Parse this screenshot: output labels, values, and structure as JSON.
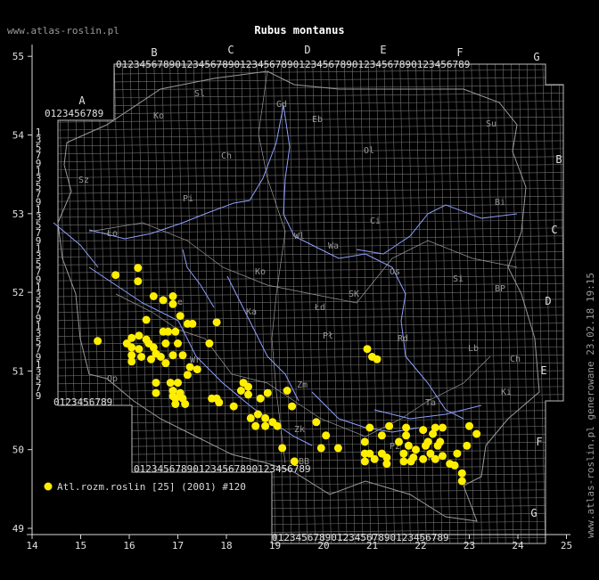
{
  "site": "www.atlas-roslin.pl",
  "title": "Rubus montanus",
  "footer_vertical": "www.atlas-roslin.pl generowane 23.02.18 19:15",
  "legend": {
    "label": "Atl.rozm.roslin [25] (2001) #120",
    "marker_color": "#ffee00"
  },
  "axes": {
    "lon_ticks": [
      "14",
      "15",
      "16",
      "17",
      "18",
      "19",
      "20",
      "21",
      "22",
      "23",
      "24",
      "25"
    ],
    "lat_ticks": [
      "49",
      "50",
      "51",
      "52",
      "53",
      "54",
      "55"
    ]
  },
  "grid_letters_top": [
    "A",
    "B",
    "C",
    "D",
    "E",
    "F",
    "G"
  ],
  "grid_letters_right": [
    "B",
    "C",
    "D",
    "E",
    "F",
    "G"
  ],
  "digit_row": "0123456789",
  "region_labels": [
    "Sl",
    "Gd",
    "Eb",
    "Ko",
    "Su",
    "Ch",
    "Ol",
    "Sz",
    "Pi",
    "Bi",
    "Ci",
    "Wl",
    "Ło",
    "Wa",
    "Ko",
    "Os",
    "Si",
    "BP",
    "Le",
    "Ka",
    "Łd",
    "SK",
    "Rd",
    "Wr",
    "Pł",
    "Lb",
    "Ch",
    "Op",
    "Zm",
    "Ki",
    "Ta",
    "Pz",
    "Kr",
    "BB",
    "Zk"
  ],
  "colors": {
    "background": "#000000",
    "grid": "#707070",
    "rivers": "#8ea0ff",
    "borders": "#9a9a9a",
    "points": "#ffee00",
    "axis": "#d8d8d8"
  },
  "chart_data": {
    "type": "scatter",
    "title": "Rubus montanus",
    "series": [
      {
        "name": "Atl.rozm.roslin [25] (2001) #120",
        "points": [
          [
            15.72,
            52.22
          ],
          [
            16.18,
            52.31
          ],
          [
            16.18,
            52.14
          ],
          [
            15.35,
            51.38
          ],
          [
            15.95,
            51.35
          ],
          [
            16.05,
            51.42
          ],
          [
            16.05,
            51.3
          ],
          [
            16.05,
            51.2
          ],
          [
            16.2,
            51.45
          ],
          [
            16.35,
            51.4
          ],
          [
            16.4,
            51.35
          ],
          [
            16.2,
            51.28
          ],
          [
            16.25,
            51.18
          ],
          [
            16.05,
            51.12
          ],
          [
            16.5,
            51.3
          ],
          [
            16.55,
            51.22
          ],
          [
            16.65,
            51.18
          ],
          [
            16.45,
            51.15
          ],
          [
            16.8,
            51.5
          ],
          [
            16.7,
            51.5
          ],
          [
            16.95,
            51.5
          ],
          [
            16.9,
            51.85
          ],
          [
            17.05,
            51.7
          ],
          [
            16.7,
            51.9
          ],
          [
            16.9,
            51.95
          ],
          [
            17.2,
            51.6
          ],
          [
            17.3,
            51.6
          ],
          [
            17.8,
            51.62
          ],
          [
            17.65,
            51.35
          ],
          [
            16.5,
            51.95
          ],
          [
            16.35,
            51.65
          ],
          [
            16.75,
            51.35
          ],
          [
            17.0,
            51.35
          ],
          [
            17.1,
            51.2
          ],
          [
            16.9,
            51.2
          ],
          [
            16.75,
            51.1
          ],
          [
            17.25,
            51.05
          ],
          [
            17.4,
            51.02
          ],
          [
            17.2,
            50.95
          ],
          [
            16.55,
            50.85
          ],
          [
            16.55,
            50.72
          ],
          [
            16.85,
            50.85
          ],
          [
            17.0,
            50.85
          ],
          [
            16.9,
            50.75
          ],
          [
            17.05,
            50.72
          ],
          [
            16.95,
            50.65
          ],
          [
            17.1,
            50.65
          ],
          [
            16.95,
            50.58
          ],
          [
            17.15,
            50.58
          ],
          [
            16.9,
            50.68
          ],
          [
            17.7,
            50.65
          ],
          [
            17.85,
            50.6
          ],
          [
            17.8,
            50.65
          ],
          [
            18.15,
            50.55
          ],
          [
            18.35,
            50.85
          ],
          [
            18.45,
            50.8
          ],
          [
            18.3,
            50.75
          ],
          [
            18.45,
            50.7
          ],
          [
            18.7,
            50.65
          ],
          [
            18.85,
            50.72
          ],
          [
            19.25,
            50.75
          ],
          [
            19.35,
            50.55
          ],
          [
            18.5,
            50.4
          ],
          [
            18.65,
            50.45
          ],
          [
            18.8,
            50.4
          ],
          [
            18.95,
            50.35
          ],
          [
            19.05,
            50.3
          ],
          [
            18.6,
            50.3
          ],
          [
            18.8,
            50.3
          ],
          [
            19.15,
            50.02
          ],
          [
            19.4,
            49.85
          ],
          [
            19.85,
            50.35
          ],
          [
            20.05,
            50.18
          ],
          [
            19.95,
            50.02
          ],
          [
            20.3,
            50.02
          ],
          [
            20.85,
            50.1
          ],
          [
            20.85,
            49.95
          ],
          [
            20.85,
            49.85
          ],
          [
            20.95,
            49.95
          ],
          [
            20.95,
            50.28
          ],
          [
            21.05,
            49.88
          ],
          [
            21.2,
            49.95
          ],
          [
            21.2,
            50.18
          ],
          [
            21.3,
            49.82
          ],
          [
            21.3,
            49.9
          ],
          [
            21.35,
            50.3
          ],
          [
            21.55,
            50.1
          ],
          [
            21.65,
            49.95
          ],
          [
            21.65,
            49.85
          ],
          [
            21.8,
            49.85
          ],
          [
            21.85,
            49.9
          ],
          [
            21.7,
            50.28
          ],
          [
            21.7,
            50.18
          ],
          [
            21.75,
            50.05
          ],
          [
            21.9,
            50.0
          ],
          [
            22.05,
            49.88
          ],
          [
            22.05,
            50.25
          ],
          [
            22.1,
            50.05
          ],
          [
            22.15,
            50.1
          ],
          [
            22.25,
            50.2
          ],
          [
            22.3,
            50.28
          ],
          [
            22.35,
            50.05
          ],
          [
            22.45,
            50.28
          ],
          [
            22.45,
            49.92
          ],
          [
            22.6,
            49.82
          ],
          [
            22.7,
            49.8
          ],
          [
            22.75,
            49.95
          ],
          [
            22.85,
            49.7
          ],
          [
            22.85,
            49.6
          ],
          [
            22.95,
            50.05
          ],
          [
            23.0,
            50.3
          ],
          [
            23.15,
            50.2
          ],
          [
            22.4,
            50.1
          ],
          [
            22.2,
            49.95
          ],
          [
            22.3,
            49.88
          ],
          [
            20.9,
            51.28
          ],
          [
            21.0,
            51.18
          ],
          [
            21.1,
            51.15
          ]
        ]
      }
    ],
    "xlim": [
      14,
      25
    ],
    "ylim": [
      49,
      55.4
    ]
  }
}
